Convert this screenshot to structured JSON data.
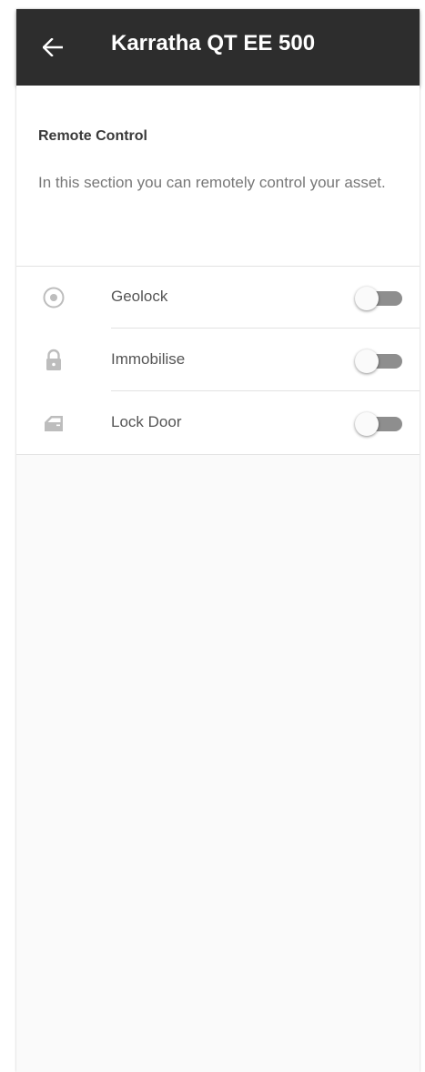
{
  "appbar": {
    "back_icon": "arrow-left-icon",
    "title": "Karratha QT EE 500",
    "background": "#2d2d2d"
  },
  "section": {
    "heading": "Remote Control",
    "description": "In this section you can remotely control your asset."
  },
  "controls": [
    {
      "label": "Geolock",
      "icon": "target-icon",
      "enabled": false
    },
    {
      "label": "Immobilise",
      "icon": "lock-icon",
      "enabled": false
    },
    {
      "label": "Lock Door",
      "icon": "car-door-icon",
      "enabled": false
    }
  ],
  "colors": {
    "toggle_track_off": "#8e8e8e",
    "toggle_thumb_off": "#fafafa",
    "icon_gray": "#bdbdbd"
  }
}
